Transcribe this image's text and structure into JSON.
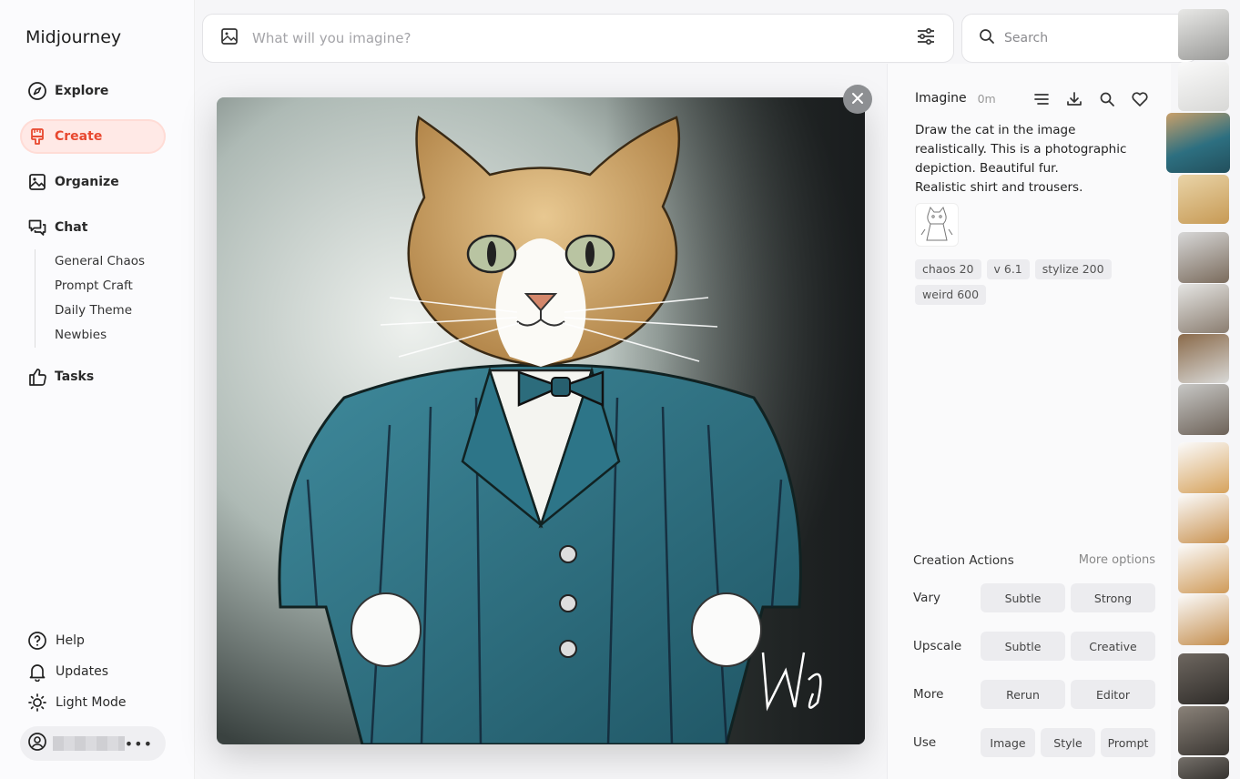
{
  "sidebar": {
    "brand": "Midjourney",
    "nav": [
      {
        "label": "Explore",
        "icon": "compass-icon"
      },
      {
        "label": "Create",
        "icon": "paintbrush-icon",
        "active": true
      },
      {
        "label": "Organize",
        "icon": "image-icon"
      },
      {
        "label": "Chat",
        "icon": "chat-icon"
      }
    ],
    "chat_rooms": [
      "General Chaos",
      "Prompt Craft",
      "Daily Theme",
      "Newbies"
    ],
    "tasks": {
      "label": "Tasks",
      "icon": "thumbs-up-icon"
    },
    "footer": [
      {
        "label": "Help",
        "icon": "help-icon"
      },
      {
        "label": "Updates",
        "icon": "bell-icon"
      },
      {
        "label": "Light Mode",
        "icon": "sun-icon"
      }
    ],
    "user_more": "•••"
  },
  "prompt_bar": {
    "placeholder": "What will you imagine?"
  },
  "search": {
    "placeholder": "Search"
  },
  "details": {
    "title": "Imagine",
    "time": "0m",
    "prompt_lines": [
      "Draw the cat in the image",
      "realistically. This is a photographic",
      "depiction. Beautiful fur.",
      "Realistic shirt and trousers."
    ],
    "params": [
      "chaos 20",
      "v 6.1",
      "stylize 200",
      "weird 600"
    ],
    "creation_actions": {
      "title": "Creation Actions",
      "more": "More options",
      "rows": [
        {
          "label": "Vary",
          "buttons": [
            "Subtle",
            "Strong"
          ]
        },
        {
          "label": "Upscale",
          "buttons": [
            "Subtle",
            "Creative"
          ]
        },
        {
          "label": "More",
          "buttons": [
            "Rerun",
            "Editor"
          ]
        },
        {
          "label": "Use",
          "buttons": [
            "Image",
            "Style",
            "Prompt"
          ]
        }
      ]
    }
  },
  "colors": {
    "accent": "#e8482f",
    "suit": "#2f6f7e"
  }
}
